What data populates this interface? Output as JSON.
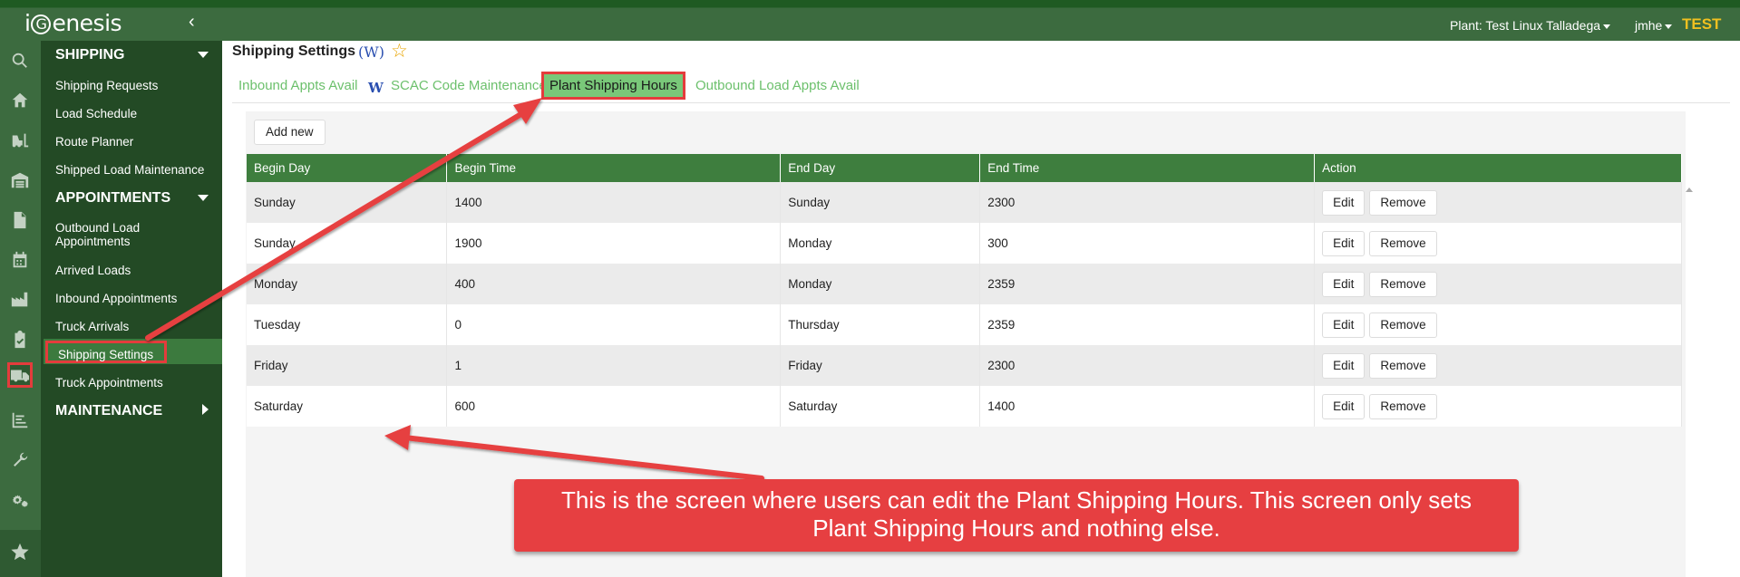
{
  "header": {
    "logo_pre": "i",
    "logo_g": "G",
    "logo_post": "enesis",
    "collapse_glyph": "‹",
    "plant_label": "Plant: Test Linux Talladega",
    "user_label": "jmhe",
    "env_label": "TEST"
  },
  "icon_rail": [
    "search-icon",
    "home-icon",
    "forklift-icon",
    "warehouse-icon",
    "document-icon",
    "calendar-icon",
    "factory-icon",
    "clipboard-check-icon",
    "truck-icon",
    "list-chart-icon",
    "wrench-icon",
    "gears-icon",
    "star-icon"
  ],
  "sidebar": {
    "sections": [
      {
        "title": "SHIPPING",
        "expanded": true,
        "items": [
          "Shipping Requests",
          "Load Schedule",
          "Route Planner",
          "Shipped Load Maintenance"
        ]
      },
      {
        "title": "APPOINTMENTS",
        "expanded": true,
        "items": [
          "Outbound Load Appointments",
          "Arrived Loads",
          "Inbound Appointments",
          "Truck Arrivals",
          "Shipping Settings",
          "Truck Appointments"
        ]
      },
      {
        "title": "MAINTENANCE",
        "expanded": false,
        "items": []
      }
    ],
    "active_item": "Shipping Settings"
  },
  "page": {
    "title": "Shipping Settings",
    "wiki_link": "(W)",
    "tabs": [
      {
        "label": "Inbound Appts Avail"
      },
      {
        "label": "SCAC Code Maintenance"
      },
      {
        "label": "Plant Shipping Hours"
      },
      {
        "label": "Outbound Load Appts Avail"
      }
    ],
    "tab_wiki": "W",
    "active_tab": "Plant Shipping Hours"
  },
  "grid": {
    "add_label": "Add new",
    "columns": [
      "Begin Day",
      "Begin Time",
      "End Day",
      "End Time",
      "Action"
    ],
    "rows": [
      [
        "Sunday",
        "1400",
        "Sunday",
        "2300"
      ],
      [
        "Sunday",
        "1900",
        "Monday",
        "300"
      ],
      [
        "Monday",
        "400",
        "Monday",
        "2359"
      ],
      [
        "Tuesday",
        "0",
        "Thursday",
        "2359"
      ],
      [
        "Friday",
        "1",
        "Friday",
        "2300"
      ],
      [
        "Saturday",
        "600",
        "Saturday",
        "1400"
      ]
    ],
    "edit_label": "Edit",
    "remove_label": "Remove"
  },
  "annotation": {
    "callout_text": "This is the screen where users can edit the Plant Shipping Hours. This screen only sets Plant Shipping Hours and nothing else.",
    "color": "#e63f41"
  },
  "colors": {
    "header_green": "#3c6b3f",
    "sidebar_green": "#234a25",
    "table_header": "#3e7e3e",
    "tab_link": "#6cc06c",
    "env_gold": "#f0c020"
  }
}
